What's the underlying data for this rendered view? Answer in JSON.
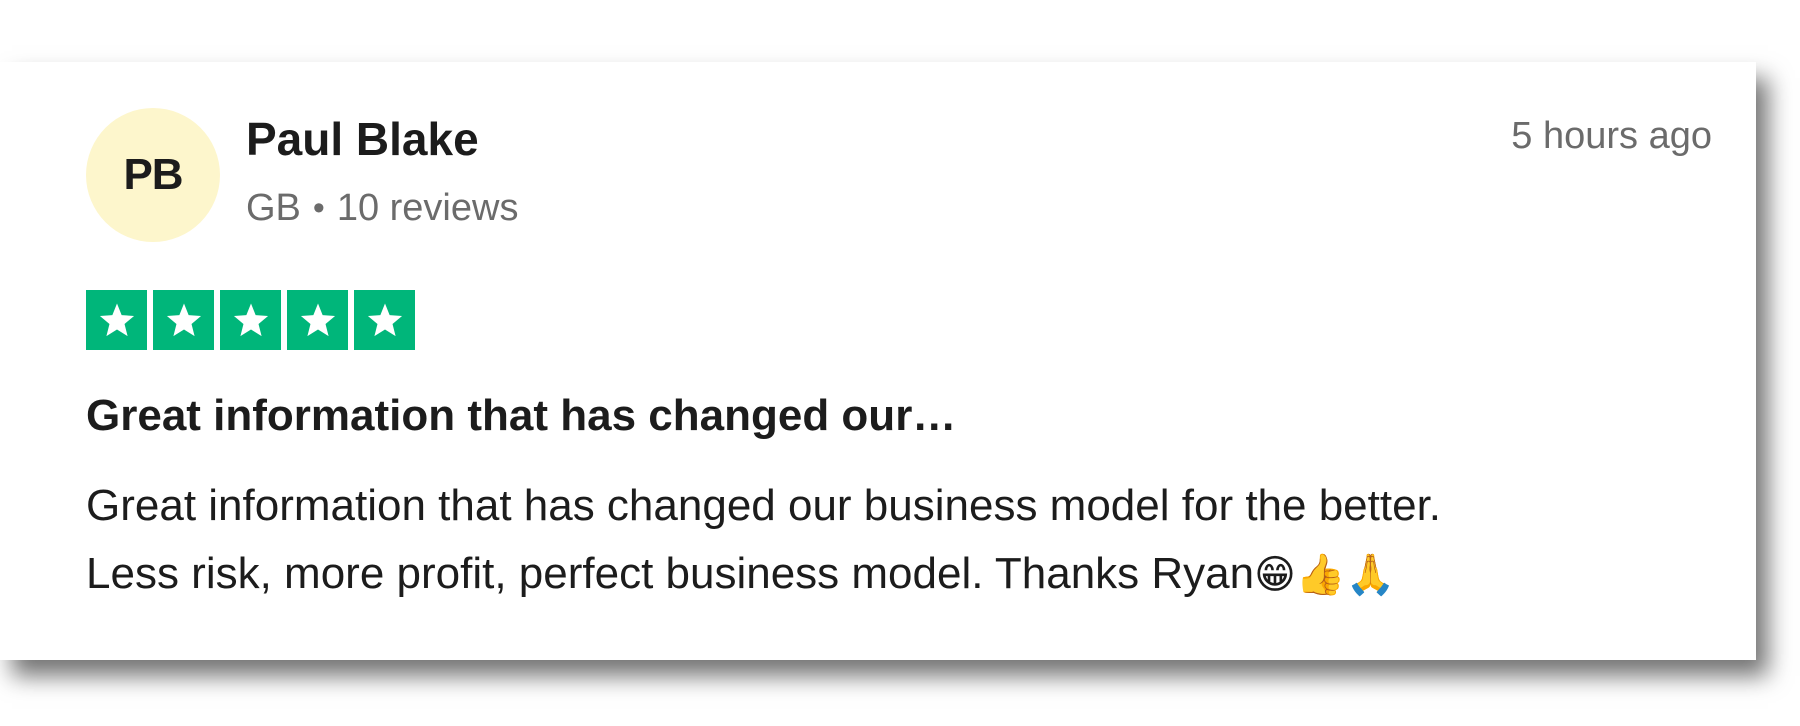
{
  "reviewer": {
    "initials": "PB",
    "name": "Paul Blake",
    "country": "GB",
    "separator": "•",
    "review_count": "10 reviews"
  },
  "timestamp": "5 hours ago",
  "rating": {
    "stars": 5,
    "max": 5,
    "color": "#00b67a",
    "icon": "star-icon"
  },
  "review": {
    "title": "Great information that has changed our…",
    "body_line1": "Great information that has changed our business model for the better.",
    "body_line2": "Less risk, more profit, perfect business model. Thanks Ryan",
    "emojis": "😁👍🙏"
  },
  "colors": {
    "avatar_bg": "#fdf6cc",
    "text_primary": "#1c1c1c",
    "text_secondary": "#6b6b6b"
  }
}
